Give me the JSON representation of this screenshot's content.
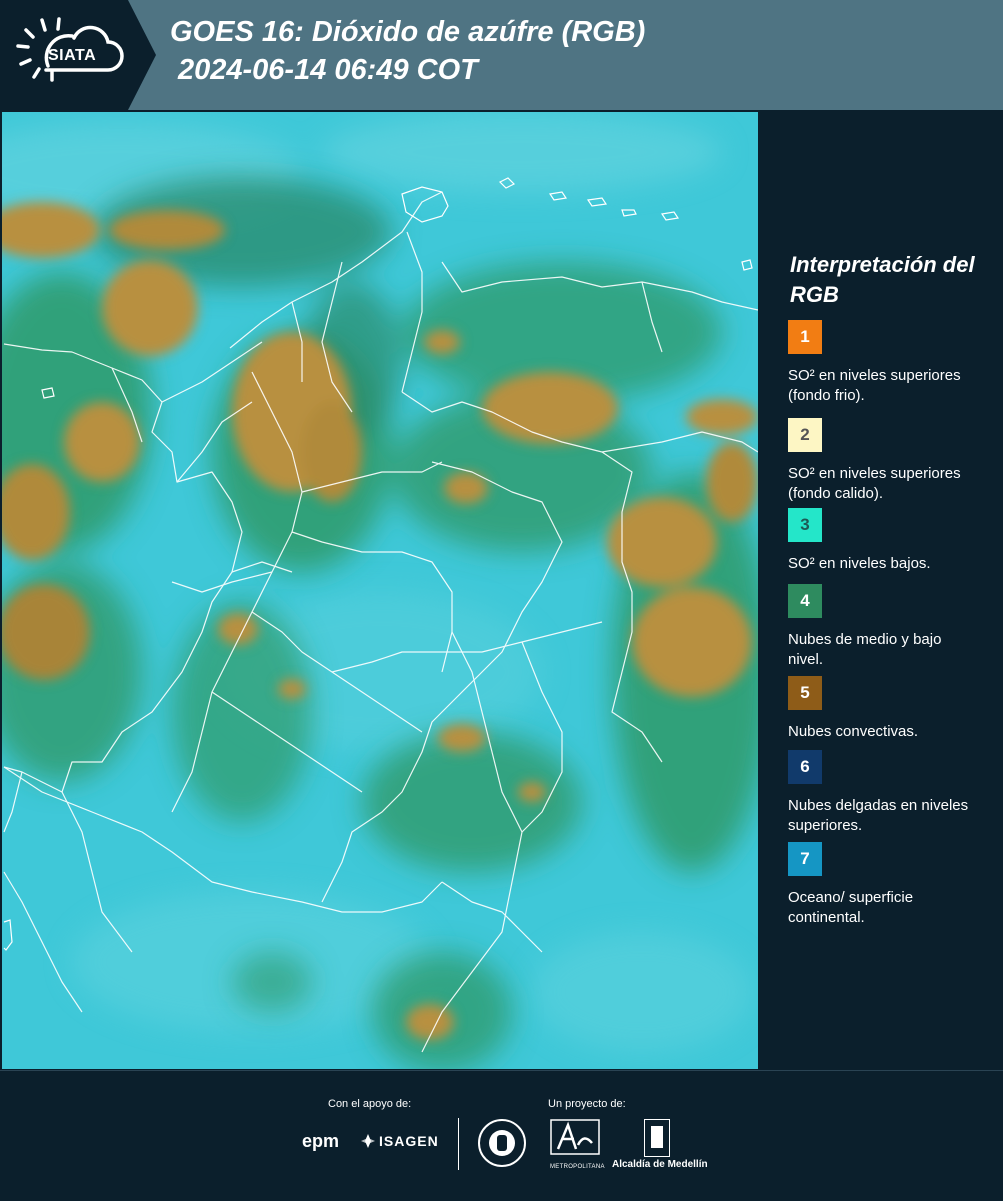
{
  "header": {
    "title_line1": "GOES 16: Dióxido de azúfre (RGB)",
    "title_line2": "2024-06-14 06:49 COT",
    "logo": "SIATA"
  },
  "legend": {
    "title": "Interpretación del RGB",
    "items": [
      {
        "number": "1",
        "label": "SO² en niveles superiores (fondo frio).",
        "color": "#f27d13",
        "text_color": "#ffffff"
      },
      {
        "number": "2",
        "label": "SO² en niveles superiores (fondo calido).",
        "color": "#fdf6c4",
        "text_color": "#555555"
      },
      {
        "number": "3",
        "label": "SO² en niveles bajos.",
        "color": "#24e6c9",
        "text_color": "#1d5a55"
      },
      {
        "number": "4",
        "label": "Nubes de medio y bajo nivel.",
        "color": "#2e8b5f",
        "text_color": "#ffffff"
      },
      {
        "number": "5",
        "label": "Nubes convectivas.",
        "color": "#8e5c18",
        "text_color": "#ffffff"
      },
      {
        "number": "6",
        "label": "Nubes delgadas en niveles superiores.",
        "color": "#113a6b",
        "text_color": "#ffffff"
      },
      {
        "number": "7",
        "label": "Oceano/ superficie continental.",
        "color": "#1596c4",
        "text_color": "#ffffff"
      }
    ]
  },
  "footer": {
    "support_label": "Con el apoyo de:",
    "project_label": "Un proyecto de:",
    "sponsors": [
      "epm",
      "ISAGEN"
    ],
    "partners": [
      "METROPOLITANA",
      "Alcaldía de Medellín"
    ]
  },
  "colors": {
    "background": "#0b1f2c",
    "header_band": "#4f7483",
    "map_base": "#3cc6d6",
    "cloud_low": "#2f9a6a",
    "cloud_convective": "#b08a3a"
  }
}
